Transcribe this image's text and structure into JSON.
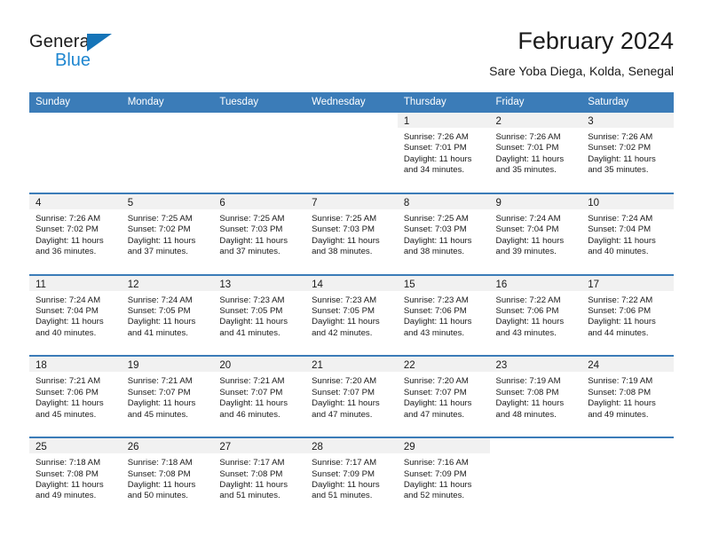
{
  "brand": {
    "name_part1": "General",
    "name_part2": "Blue",
    "triangle_color": "#1574b8",
    "blue_text_color": "#1e86d0"
  },
  "header": {
    "title": "February 2024",
    "subtitle": "Sare Yoba Diega, Kolda, Senegal"
  },
  "theme": {
    "header_blue": "#3b7cb8",
    "divider_blue": "#3b7cb8",
    "daynum_band": "#f1f1f1",
    "text": "#1a1a1a"
  },
  "weekdays": [
    "Sunday",
    "Monday",
    "Tuesday",
    "Wednesday",
    "Thursday",
    "Friday",
    "Saturday"
  ],
  "weeks": [
    [
      {
        "day": "",
        "lines": []
      },
      {
        "day": "",
        "lines": []
      },
      {
        "day": "",
        "lines": []
      },
      {
        "day": "",
        "lines": []
      },
      {
        "day": "1",
        "lines": [
          "Sunrise: 7:26 AM",
          "Sunset: 7:01 PM",
          "Daylight: 11 hours",
          "and 34 minutes."
        ]
      },
      {
        "day": "2",
        "lines": [
          "Sunrise: 7:26 AM",
          "Sunset: 7:01 PM",
          "Daylight: 11 hours",
          "and 35 minutes."
        ]
      },
      {
        "day": "3",
        "lines": [
          "Sunrise: 7:26 AM",
          "Sunset: 7:02 PM",
          "Daylight: 11 hours",
          "and 35 minutes."
        ]
      }
    ],
    [
      {
        "day": "4",
        "lines": [
          "Sunrise: 7:26 AM",
          "Sunset: 7:02 PM",
          "Daylight: 11 hours",
          "and 36 minutes."
        ]
      },
      {
        "day": "5",
        "lines": [
          "Sunrise: 7:25 AM",
          "Sunset: 7:02 PM",
          "Daylight: 11 hours",
          "and 37 minutes."
        ]
      },
      {
        "day": "6",
        "lines": [
          "Sunrise: 7:25 AM",
          "Sunset: 7:03 PM",
          "Daylight: 11 hours",
          "and 37 minutes."
        ]
      },
      {
        "day": "7",
        "lines": [
          "Sunrise: 7:25 AM",
          "Sunset: 7:03 PM",
          "Daylight: 11 hours",
          "and 38 minutes."
        ]
      },
      {
        "day": "8",
        "lines": [
          "Sunrise: 7:25 AM",
          "Sunset: 7:03 PM",
          "Daylight: 11 hours",
          "and 38 minutes."
        ]
      },
      {
        "day": "9",
        "lines": [
          "Sunrise: 7:24 AM",
          "Sunset: 7:04 PM",
          "Daylight: 11 hours",
          "and 39 minutes."
        ]
      },
      {
        "day": "10",
        "lines": [
          "Sunrise: 7:24 AM",
          "Sunset: 7:04 PM",
          "Daylight: 11 hours",
          "and 40 minutes."
        ]
      }
    ],
    [
      {
        "day": "11",
        "lines": [
          "Sunrise: 7:24 AM",
          "Sunset: 7:04 PM",
          "Daylight: 11 hours",
          "and 40 minutes."
        ]
      },
      {
        "day": "12",
        "lines": [
          "Sunrise: 7:24 AM",
          "Sunset: 7:05 PM",
          "Daylight: 11 hours",
          "and 41 minutes."
        ]
      },
      {
        "day": "13",
        "lines": [
          "Sunrise: 7:23 AM",
          "Sunset: 7:05 PM",
          "Daylight: 11 hours",
          "and 41 minutes."
        ]
      },
      {
        "day": "14",
        "lines": [
          "Sunrise: 7:23 AM",
          "Sunset: 7:05 PM",
          "Daylight: 11 hours",
          "and 42 minutes."
        ]
      },
      {
        "day": "15",
        "lines": [
          "Sunrise: 7:23 AM",
          "Sunset: 7:06 PM",
          "Daylight: 11 hours",
          "and 43 minutes."
        ]
      },
      {
        "day": "16",
        "lines": [
          "Sunrise: 7:22 AM",
          "Sunset: 7:06 PM",
          "Daylight: 11 hours",
          "and 43 minutes."
        ]
      },
      {
        "day": "17",
        "lines": [
          "Sunrise: 7:22 AM",
          "Sunset: 7:06 PM",
          "Daylight: 11 hours",
          "and 44 minutes."
        ]
      }
    ],
    [
      {
        "day": "18",
        "lines": [
          "Sunrise: 7:21 AM",
          "Sunset: 7:06 PM",
          "Daylight: 11 hours",
          "and 45 minutes."
        ]
      },
      {
        "day": "19",
        "lines": [
          "Sunrise: 7:21 AM",
          "Sunset: 7:07 PM",
          "Daylight: 11 hours",
          "and 45 minutes."
        ]
      },
      {
        "day": "20",
        "lines": [
          "Sunrise: 7:21 AM",
          "Sunset: 7:07 PM",
          "Daylight: 11 hours",
          "and 46 minutes."
        ]
      },
      {
        "day": "21",
        "lines": [
          "Sunrise: 7:20 AM",
          "Sunset: 7:07 PM",
          "Daylight: 11 hours",
          "and 47 minutes."
        ]
      },
      {
        "day": "22",
        "lines": [
          "Sunrise: 7:20 AM",
          "Sunset: 7:07 PM",
          "Daylight: 11 hours",
          "and 47 minutes."
        ]
      },
      {
        "day": "23",
        "lines": [
          "Sunrise: 7:19 AM",
          "Sunset: 7:08 PM",
          "Daylight: 11 hours",
          "and 48 minutes."
        ]
      },
      {
        "day": "24",
        "lines": [
          "Sunrise: 7:19 AM",
          "Sunset: 7:08 PM",
          "Daylight: 11 hours",
          "and 49 minutes."
        ]
      }
    ],
    [
      {
        "day": "25",
        "lines": [
          "Sunrise: 7:18 AM",
          "Sunset: 7:08 PM",
          "Daylight: 11 hours",
          "and 49 minutes."
        ]
      },
      {
        "day": "26",
        "lines": [
          "Sunrise: 7:18 AM",
          "Sunset: 7:08 PM",
          "Daylight: 11 hours",
          "and 50 minutes."
        ]
      },
      {
        "day": "27",
        "lines": [
          "Sunrise: 7:17 AM",
          "Sunset: 7:08 PM",
          "Daylight: 11 hours",
          "and 51 minutes."
        ]
      },
      {
        "day": "28",
        "lines": [
          "Sunrise: 7:17 AM",
          "Sunset: 7:09 PM",
          "Daylight: 11 hours",
          "and 51 minutes."
        ]
      },
      {
        "day": "29",
        "lines": [
          "Sunrise: 7:16 AM",
          "Sunset: 7:09 PM",
          "Daylight: 11 hours",
          "and 52 minutes."
        ]
      },
      {
        "day": "",
        "lines": []
      },
      {
        "day": "",
        "lines": []
      }
    ]
  ]
}
